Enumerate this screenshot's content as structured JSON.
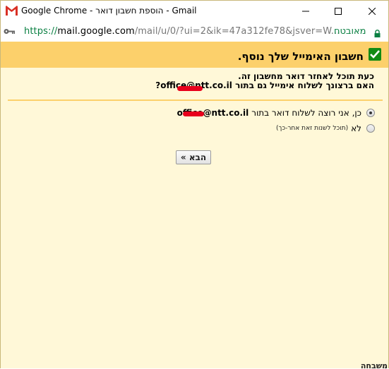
{
  "window": {
    "title": "Google Chrome - הוספת חשבון דואר - Gmail"
  },
  "address_bar": {
    "url_scheme": "https://",
    "url_host": "mail.google.com",
    "url_path": "/mail/u/0/?ui=2&ik=47a312fe78&jsver=W...",
    "secure_label": "מאובטח"
  },
  "dialog": {
    "title": "חשבון האימייל שלך נוסף.",
    "intro_line1": "כעת תוכל לאחזר דואר מחשבון זה.",
    "intro_line2_prefix": "האם ברצונך לשלוח אימייל גם בתור",
    "intro_email": "office@ntt.co.il",
    "intro_line2_suffix": "?",
    "option_yes_text": "כן, אני רוצה לשלוח דואר בתור",
    "option_yes_email": "office@ntt.co.il",
    "option_no_text": "לא",
    "option_no_note": "(תוכל לשנות זאת אחר-כך)",
    "next_button": "הבא »"
  },
  "background_fragment": "משבחה"
}
